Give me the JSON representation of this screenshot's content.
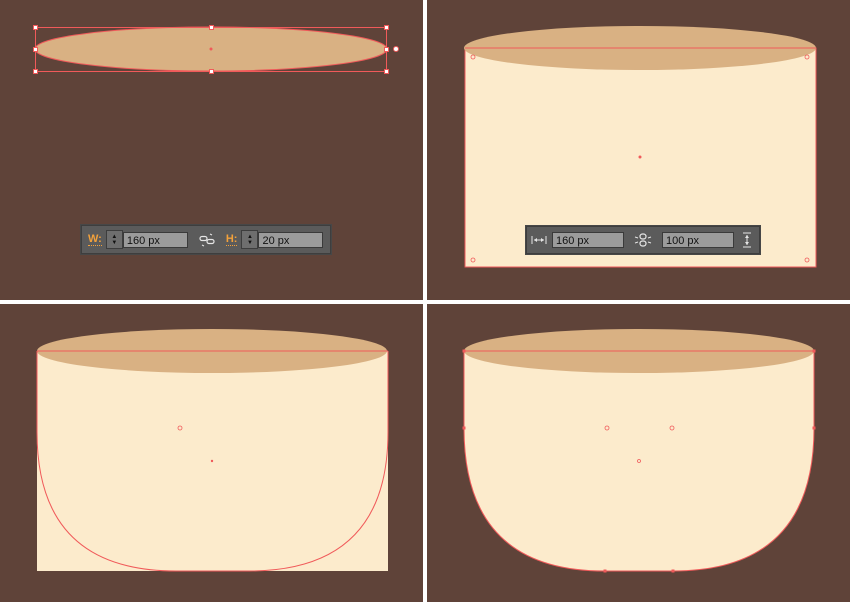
{
  "colors": {
    "background": "#5f4339",
    "rim": "#d9b183",
    "body": "#fcebcc",
    "selection": "#f05a5a",
    "toolbar": "#5b5b5b",
    "label_accent": "#f2a13b"
  },
  "panel1": {
    "toolbar": {
      "width_label": "W:",
      "width_value": "160 px",
      "link_icon": "link-constraint-icon",
      "height_label": "H:",
      "height_value": "20 px"
    }
  },
  "panel2": {
    "toolbar": {
      "width_icon": "horizontal-width-icon",
      "width_value": "160 px",
      "link_icon": "link-constraint-icon",
      "height_value": "100 px",
      "height_icon": "vertical-height-icon"
    }
  }
}
